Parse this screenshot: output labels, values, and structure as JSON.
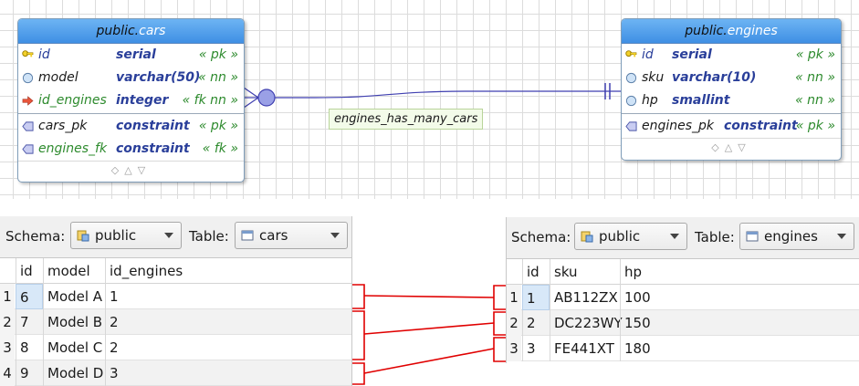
{
  "diagram": {
    "cars_entity": {
      "schema": "public.",
      "name": "cars",
      "columns": [
        {
          "name": "id",
          "type": "serial",
          "constraint": "« pk »",
          "icon": "primary-key-icon"
        },
        {
          "name": "model",
          "type": "varchar(50)",
          "constraint": "« nn »",
          "icon": "column-circle-icon"
        },
        {
          "name": "id_engines",
          "type": "integer",
          "constraint": "« fk nn »",
          "icon": "foreign-key-arrow-icon"
        }
      ],
      "constraints": [
        {
          "name": "cars_pk",
          "type": "constraint",
          "constraint": "« pk »",
          "icon": "constraint-icon"
        },
        {
          "name": "engines_fk",
          "type": "constraint",
          "constraint": "« fk »",
          "icon": "constraint-icon"
        }
      ]
    },
    "engines_entity": {
      "schema": "public.",
      "name": "engines",
      "columns": [
        {
          "name": "id",
          "type": "serial",
          "constraint": "« pk »",
          "icon": "primary-key-icon"
        },
        {
          "name": "sku",
          "type": "varchar(10)",
          "constraint": "« nn »",
          "icon": "column-circle-icon"
        },
        {
          "name": "hp",
          "type": "smallint",
          "constraint": "« nn »",
          "icon": "column-circle-icon"
        }
      ],
      "constraints": [
        {
          "name": "engines_pk",
          "type": "constraint",
          "constraint": "« pk »",
          "icon": "constraint-icon"
        }
      ]
    },
    "relationship_label": "engines_has_many_cars",
    "colors": {
      "header_blue": "#4a9be8",
      "pk_blue": "#2a3f9a",
      "fk_green": "#2e8b2e",
      "relation_line": "#3f3fb0",
      "mapping_line": "#e00000"
    }
  },
  "cars_panel": {
    "schema_label": "Schema:",
    "schema_value": "public",
    "table_label": "Table:",
    "table_value": "cars",
    "headers": [
      "id",
      "model",
      "id_engines"
    ],
    "rows": [
      {
        "num": "1",
        "id": "6",
        "model": "Model A",
        "id_engines": "1"
      },
      {
        "num": "2",
        "id": "7",
        "model": "Model B",
        "id_engines": "2"
      },
      {
        "num": "3",
        "id": "8",
        "model": "Model C",
        "id_engines": "2"
      },
      {
        "num": "4",
        "id": "9",
        "model": "Model D",
        "id_engines": "3"
      }
    ]
  },
  "engines_panel": {
    "schema_label": "Schema:",
    "schema_value": "public",
    "table_label": "Table:",
    "table_value": "engines",
    "headers": [
      "id",
      "sku",
      "hp"
    ],
    "rows": [
      {
        "num": "1",
        "id": "1",
        "sku": "AB112ZX",
        "hp": "100"
      },
      {
        "num": "2",
        "id": "2",
        "sku": "DC223WY",
        "hp": "150"
      },
      {
        "num": "3",
        "id": "3",
        "sku": "FE441XT",
        "hp": "180"
      }
    ]
  }
}
